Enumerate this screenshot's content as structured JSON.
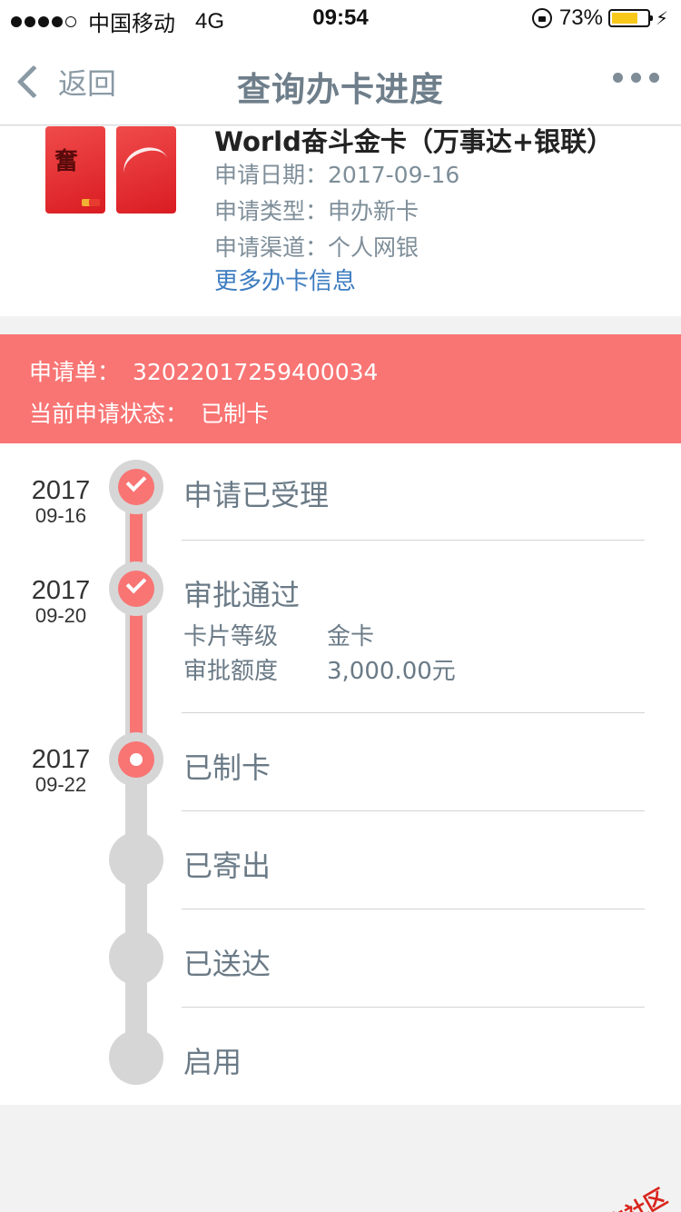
{
  "status_bar": {
    "carrier": "中国移动",
    "network": "4G",
    "time": "09:54",
    "battery_percent": "73%",
    "battery_level": 0.73,
    "battery_color": "#f8c91b"
  },
  "nav": {
    "back_label": "返回",
    "title": "查询办卡进度"
  },
  "card": {
    "name": "World奋斗金卡（万事达+银联）",
    "apply_date_label": "申请日期：",
    "apply_date": "2017-09-16",
    "apply_type_label": "申请类型：",
    "apply_type": "申办新卡",
    "channel_label": "申请渠道：",
    "channel": "个人网银",
    "more_info_link": "更多办卡信息"
  },
  "application": {
    "number_label": "申请单：",
    "number": "32022017259400034",
    "status_label": "当前申请状态：",
    "status": "已制卡",
    "accent_color": "#f87574"
  },
  "timeline": {
    "steps": [
      {
        "title": "申请已受理",
        "year": "2017",
        "date": "09-16",
        "state": "done"
      },
      {
        "title": "审批通过",
        "year": "2017",
        "date": "09-20",
        "state": "done",
        "details": [
          {
            "label": "卡片等级",
            "value": "金卡"
          },
          {
            "label": "审批额度",
            "value": "3,000.00元"
          }
        ]
      },
      {
        "title": "已制卡",
        "year": "2017",
        "date": "09-22",
        "state": "current"
      },
      {
        "title": "已寄出",
        "year": "",
        "date": "",
        "state": "pending"
      },
      {
        "title": "已送达",
        "year": "",
        "date": "",
        "state": "pending"
      },
      {
        "title": "启用",
        "year": "",
        "date": "",
        "state": "pending"
      }
    ]
  },
  "watermark": {
    "text": "卡农社区"
  }
}
